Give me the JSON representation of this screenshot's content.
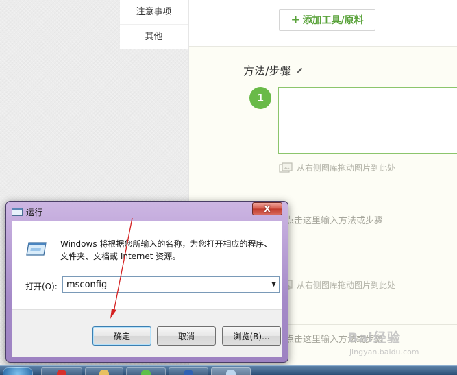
{
  "side_nav": {
    "items": [
      {
        "label": "注意事项"
      },
      {
        "label": "其他"
      }
    ]
  },
  "editor": {
    "add_tools_button": {
      "plus": "+",
      "label": "添加工具/原料"
    },
    "steps_title": "方法/步骤",
    "step_number": "1",
    "image_hint": "从右侧图库拖动图片到此处",
    "step_placeholder": "点击这里输入方法或步骤"
  },
  "watermark": {
    "brand": "Bai经验",
    "url": "jingyan.baidu.com"
  },
  "run_dialog": {
    "title": "运行",
    "close_label": "X",
    "description": "Windows 将根据您所输入的名称，为您打开相应的程序、文件夹、文档或 Internet 资源。",
    "open_label": "打开(O):",
    "open_value": "msconfig",
    "buttons": {
      "ok": "确定",
      "cancel": "取消",
      "browse": "浏览(B)..."
    }
  },
  "colors": {
    "accent_green": "#69ba48",
    "arrow_red": "#d42020",
    "dialog_frame": "#a58ac8",
    "close_red": "#c0392b"
  },
  "icons": {
    "pencil": "pencil-icon",
    "image": "image-icon",
    "run": "run-program-icon",
    "dropdown": "chevron-down-icon",
    "close": "close-icon"
  }
}
